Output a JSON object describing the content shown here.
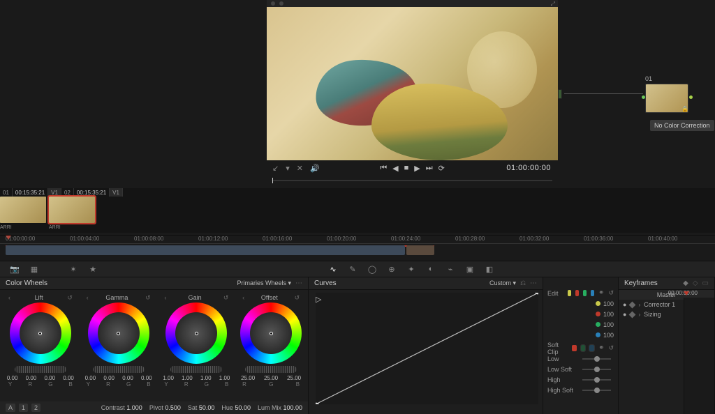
{
  "viewer": {
    "timecode": "01:00:00:00"
  },
  "node": {
    "label": "01",
    "tooltip": "No Color Correction"
  },
  "clips": [
    {
      "idx": "01",
      "tc": "00:15:35:21",
      "track": "V1",
      "codec": "ARRI"
    },
    {
      "idx": "02",
      "tc": "00:15:35:21",
      "track": "V1",
      "codec": "ARRI"
    }
  ],
  "ruler": [
    "01:00:00:00",
    "01:00:04:00",
    "01:00:08:00",
    "01:00:12:00",
    "01:00:16:00",
    "01:00:20:00",
    "01:00:24:00",
    "01:00:28:00",
    "01:00:32:00",
    "01:00:36:00",
    "01:00:40:00"
  ],
  "color_wheels": {
    "title": "Color Wheels",
    "mode": "Primaries Wheels",
    "wheels": [
      {
        "name": "Lift",
        "vals": [
          "0.00",
          "0.00",
          "0.00",
          "0.00"
        ],
        "labs": [
          "Y",
          "R",
          "G",
          "B"
        ]
      },
      {
        "name": "Gamma",
        "vals": [
          "0.00",
          "0.00",
          "0.00",
          "0.00"
        ],
        "labs": [
          "Y",
          "R",
          "G",
          "B"
        ]
      },
      {
        "name": "Gain",
        "vals": [
          "1.00",
          "1.00",
          "1.00",
          "1.00"
        ],
        "labs": [
          "Y",
          "R",
          "G",
          "B"
        ]
      },
      {
        "name": "Offset",
        "vals": [
          "25.00",
          "25.00",
          "25.00"
        ],
        "labs": [
          "R",
          "G",
          "B"
        ]
      }
    ],
    "page_a": "A",
    "page_1": "1",
    "page_2": "2",
    "params": [
      {
        "l": "Contrast",
        "v": "1.000"
      },
      {
        "l": "Pivot",
        "v": "0.500"
      },
      {
        "l": "Sat",
        "v": "50.00"
      },
      {
        "l": "Hue",
        "v": "50.00"
      },
      {
        "l": "Lum Mix",
        "v": "100.00"
      }
    ]
  },
  "curves": {
    "title": "Curves",
    "mode": "Custom"
  },
  "edit": {
    "title": "Edit",
    "vals": [
      "100",
      "100",
      "100",
      "100"
    ],
    "softclip": {
      "title": "Soft Clip",
      "rows": [
        "Low",
        "Low Soft",
        "High",
        "High Soft"
      ]
    }
  },
  "keyframes": {
    "title": "Keyframes",
    "tc": "00:00:00:00",
    "master": "Master",
    "items": [
      "Corrector 1",
      "Sizing"
    ]
  }
}
